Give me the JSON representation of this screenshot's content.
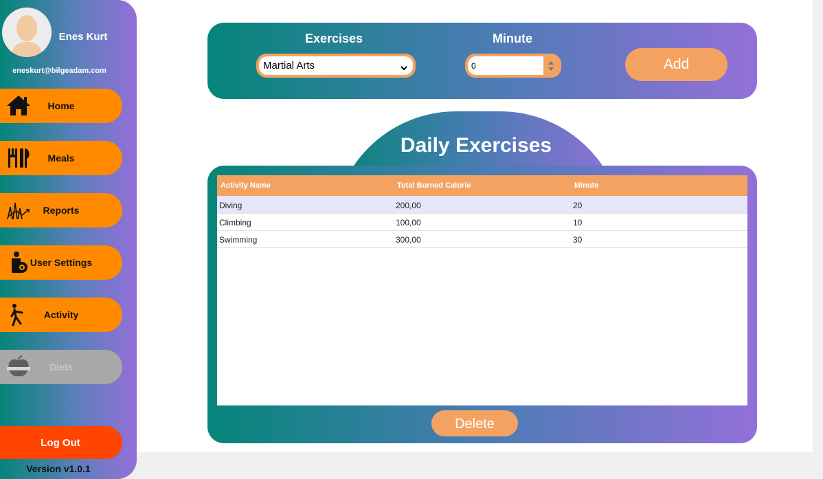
{
  "user": {
    "name": "Enes Kurt",
    "email": "eneskurt@bilgeadam.com"
  },
  "nav": {
    "home": "Home",
    "meals": "Meals",
    "reports": "Reports",
    "user_settings": "User Settings",
    "activity": "Activity",
    "diets": "Diets"
  },
  "logout_label": "Log Out",
  "version": "Version v1.0.1",
  "form": {
    "exercises_label": "Exercises",
    "exercise_selected": "Martial Arts",
    "minute_label": "Minute",
    "minute_value": "0",
    "add_label": "Add"
  },
  "daily": {
    "title": "Daily Exercises",
    "columns": [
      "Activity Name",
      "Total Burned Calorie",
      "Minute"
    ],
    "rows": [
      [
        "Diving",
        "200,00",
        "20"
      ],
      [
        "Climbing",
        "100,00",
        "10"
      ],
      [
        "Swimming",
        "300,00",
        "30"
      ]
    ],
    "delete_label": "Delete"
  },
  "colors": {
    "accent_orange": "#ff8a00",
    "peach": "#f4a261",
    "logout_red": "#ff4500",
    "gradient_start": "#058579",
    "gradient_end": "#9470d9",
    "selected_row": "#e6e6fa"
  },
  "icons": [
    "avatar",
    "home-icon",
    "cutlery-icon",
    "chart-icon",
    "user-gear-icon",
    "running-person-icon",
    "apple-icon",
    "chevron-down-icon",
    "spinner-icon"
  ]
}
